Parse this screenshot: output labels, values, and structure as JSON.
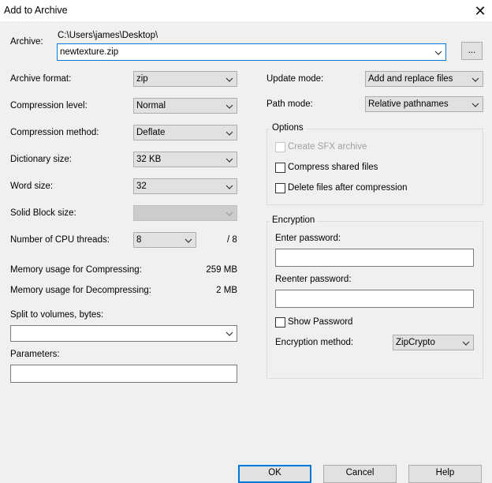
{
  "window": {
    "title": "Add to Archive",
    "close_icon": "close-icon"
  },
  "archive": {
    "label": "Archive:",
    "path": "C:\\Users\\james\\Desktop\\",
    "filename": "newtexture.zip",
    "browse_label": "..."
  },
  "left": {
    "format_label": "Archive format:",
    "format_value": "zip",
    "level_label": "Compression level:",
    "level_value": "Normal",
    "method_label": "Compression method:",
    "method_value": "Deflate",
    "dict_label": "Dictionary size:",
    "dict_value": "32 KB",
    "word_label": "Word size:",
    "word_value": "32",
    "solid_label": "Solid Block size:",
    "solid_value": "",
    "threads_label": "Number of CPU threads:",
    "threads_value": "8",
    "threads_total": "/ 8",
    "mem_comp_label": "Memory usage for Compressing:",
    "mem_comp_value": "259 MB",
    "mem_decomp_label": "Memory usage for Decompressing:",
    "mem_decomp_value": "2 MB",
    "split_label": "Split to volumes, bytes:",
    "split_value": "",
    "params_label": "Parameters:",
    "params_value": ""
  },
  "right": {
    "update_label": "Update mode:",
    "update_value": "Add and replace files",
    "path_label": "Path mode:",
    "path_value": "Relative pathnames",
    "options": {
      "title": "Options",
      "sfx_label": "Create SFX archive",
      "shared_label": "Compress shared files",
      "delete_label": "Delete files after compression"
    },
    "encryption": {
      "title": "Encryption",
      "enter_label": "Enter password:",
      "reenter_label": "Reenter password:",
      "show_label": "Show Password",
      "method_label": "Encryption method:",
      "method_value": "ZipCrypto"
    }
  },
  "buttons": {
    "ok": "OK",
    "cancel": "Cancel",
    "help": "Help"
  }
}
